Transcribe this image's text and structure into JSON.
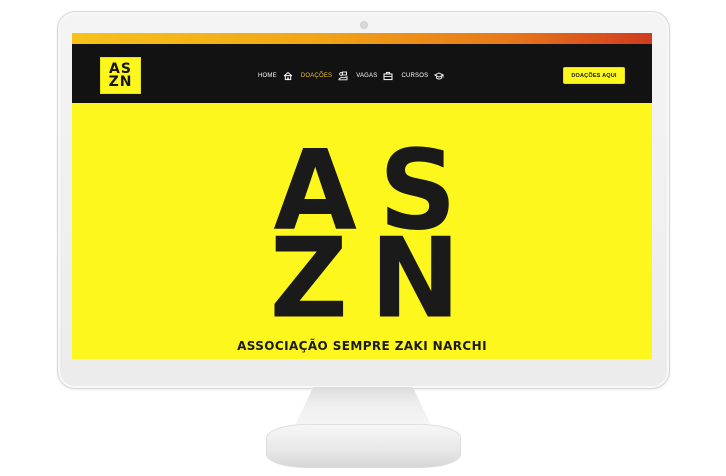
{
  "site": {
    "logo_text_line1": "AS",
    "logo_text_line2": "ZN",
    "nav": [
      {
        "label": "HOME",
        "icon": "home-icon",
        "active": false
      },
      {
        "label": "DOAÇÕES",
        "icon": "donation-icon",
        "active": true
      },
      {
        "label": "VAGAS",
        "icon": "briefcase-icon",
        "active": false
      },
      {
        "label": "CURSOS",
        "icon": "graduation-cap-icon",
        "active": false
      }
    ],
    "cta_label": "DOAÇÕES AQUI",
    "hero": {
      "line1": "AS",
      "line2": "ZN",
      "subtitle": "ASSOCIAÇÃO SEMPRE ZAKI NARCHI"
    },
    "colors": {
      "primary_yellow": "#fef71d",
      "nav_bg": "#121212",
      "active_link": "#f2c21a",
      "text_dark": "#1a1a1a"
    }
  }
}
